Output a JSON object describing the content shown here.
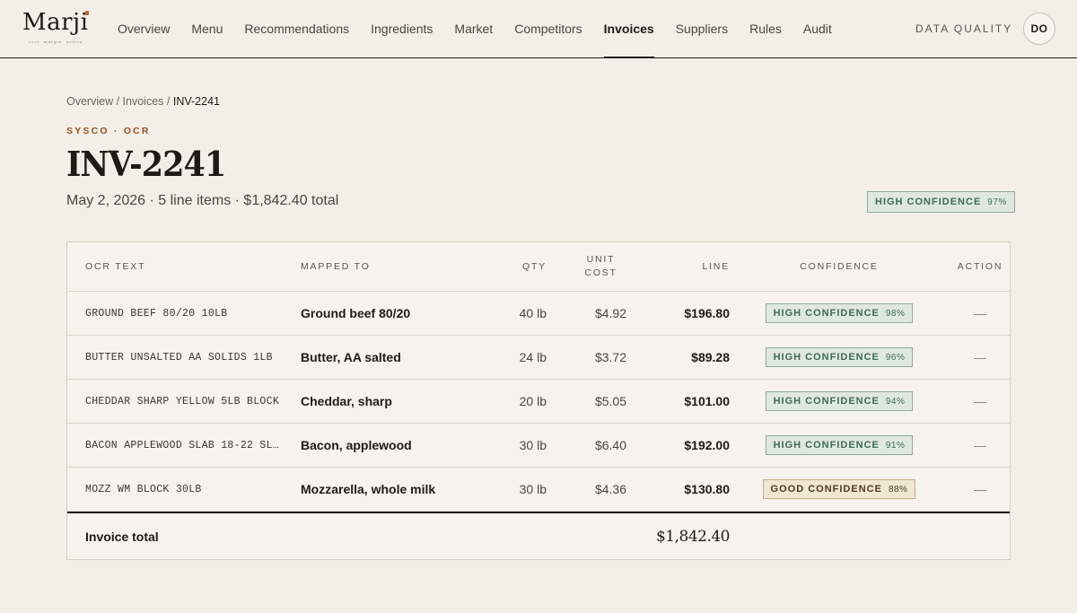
{
  "brand": {
    "name": "Marji",
    "tagline": "cost. margin. action."
  },
  "nav": {
    "items": [
      {
        "label": "Overview",
        "active": false
      },
      {
        "label": "Menu",
        "active": false
      },
      {
        "label": "Recommendations",
        "active": false
      },
      {
        "label": "Ingredients",
        "active": false
      },
      {
        "label": "Market",
        "active": false
      },
      {
        "label": "Competitors",
        "active": false
      },
      {
        "label": "Invoices",
        "active": true
      },
      {
        "label": "Suppliers",
        "active": false
      },
      {
        "label": "Rules",
        "active": false
      },
      {
        "label": "Audit",
        "active": false
      }
    ],
    "data_quality_label": "DATA QUALITY",
    "avatar_initials": "DO"
  },
  "breadcrumb": {
    "root": "Overview",
    "section": "Invoices",
    "current": "INV-2241",
    "separator": "/"
  },
  "invoice": {
    "eyebrow": "SYSCO · OCR",
    "title": "INV-2241",
    "subtitle": "May 2, 2026 · 5 line items · $1,842.40 total",
    "confidence_label": "HIGH CONFIDENCE",
    "confidence_pct": "97%"
  },
  "table": {
    "headers": {
      "ocr_text": "OCR TEXT",
      "mapped_to": "MAPPED TO",
      "qty": "QTY",
      "unit_cost_1": "UNIT",
      "unit_cost_2": "COST",
      "line": "LINE",
      "confidence": "CONFIDENCE",
      "action": "ACTION"
    },
    "rows": [
      {
        "ocr": "GROUND BEEF 80/20 10LB",
        "mapped": "Ground beef 80/20",
        "qty": "40 lb",
        "unit": "$4.92",
        "line": "$196.80",
        "conf_label": "HIGH CONFIDENCE",
        "conf_pct": "98%",
        "level": "high",
        "action": "—"
      },
      {
        "ocr": "BUTTER UNSALTED AA SOLIDS 1LB",
        "mapped": "Butter, AA salted",
        "qty": "24 lb",
        "unit": "$3.72",
        "line": "$89.28",
        "conf_label": "HIGH CONFIDENCE",
        "conf_pct": "96%",
        "level": "high",
        "action": "—"
      },
      {
        "ocr": "CHEDDAR SHARP YELLOW 5LB BLOCK",
        "mapped": "Cheddar, sharp",
        "qty": "20 lb",
        "unit": "$5.05",
        "line": "$101.00",
        "conf_label": "HIGH CONFIDENCE",
        "conf_pct": "94%",
        "level": "high",
        "action": "—"
      },
      {
        "ocr": "BACON APPLEWOOD SLAB 18-22 SL…",
        "mapped": "Bacon, applewood",
        "qty": "30 lb",
        "unit": "$6.40",
        "line": "$192.00",
        "conf_label": "HIGH CONFIDENCE",
        "conf_pct": "91%",
        "level": "high",
        "action": "—"
      },
      {
        "ocr": "MOZZ WM BLOCK 30LB",
        "mapped": "Mozzarella, whole milk",
        "qty": "30 lb",
        "unit": "$4.36",
        "line": "$130.80",
        "conf_label": "GOOD CONFIDENCE",
        "conf_pct": "88%",
        "level": "good",
        "action": "—"
      }
    ],
    "total_label": "Invoice total",
    "total_value": "$1,842.40"
  },
  "colors": {
    "background": "#f3efe8",
    "accent": "#9a4e22",
    "high_confidence": "#3f6b53",
    "good_confidence": "#4a3a22"
  }
}
